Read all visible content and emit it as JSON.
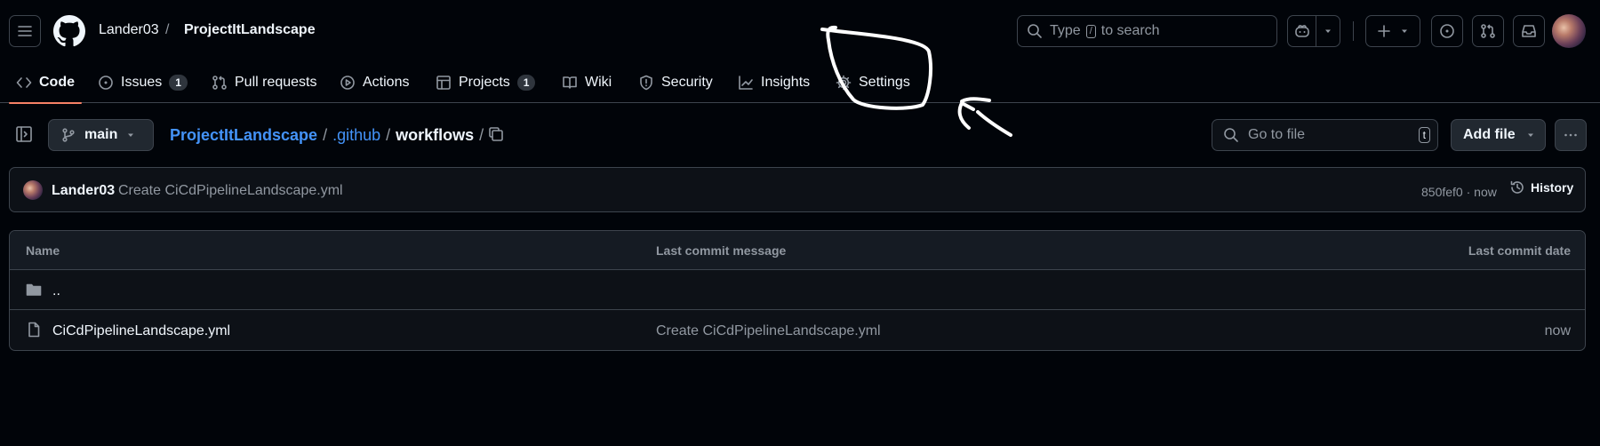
{
  "header": {
    "owner": "Lander03",
    "separator": "/",
    "repo": "ProjectItLandscape",
    "search": {
      "prefix": "Type",
      "key": "/",
      "suffix": "to search"
    }
  },
  "nav": {
    "tabs": [
      {
        "label": "Code",
        "icon": "code-icon",
        "selected": true
      },
      {
        "label": "Issues",
        "icon": "issue-opened-icon",
        "count": "1"
      },
      {
        "label": "Pull requests",
        "icon": "git-pull-request-icon"
      },
      {
        "label": "Actions",
        "icon": "play-icon"
      },
      {
        "label": "Projects",
        "icon": "table-icon",
        "count": "1"
      },
      {
        "label": "Wiki",
        "icon": "book-icon"
      },
      {
        "label": "Security",
        "icon": "shield-icon"
      },
      {
        "label": "Insights",
        "icon": "graph-icon"
      },
      {
        "label": "Settings",
        "icon": "gear-icon"
      }
    ]
  },
  "path": {
    "branch": "main",
    "repo_link": "ProjectItLandscape",
    "sep": "/",
    "dir1": ".github",
    "current": "workflows",
    "trailing": "/"
  },
  "goto": {
    "placeholder": "Go to file",
    "key": "t"
  },
  "add_file": "Add file",
  "commit": {
    "author": "Lander03",
    "message": "Create CiCdPipelineLandscape.yml",
    "meta": "850fef0 · now",
    "history": "History"
  },
  "table": {
    "columns": [
      "Name",
      "Last commit message",
      "Last commit date"
    ],
    "parent": "..",
    "rows": [
      {
        "name": "CiCdPipelineLandscape.yml",
        "message": "Create CiCdPipelineLandscape.yml",
        "date": "now"
      }
    ]
  },
  "colors": {
    "background": "#010409",
    "link": "#4493f8",
    "tab_underline": "#f78166",
    "annotation": "#ffffff"
  }
}
